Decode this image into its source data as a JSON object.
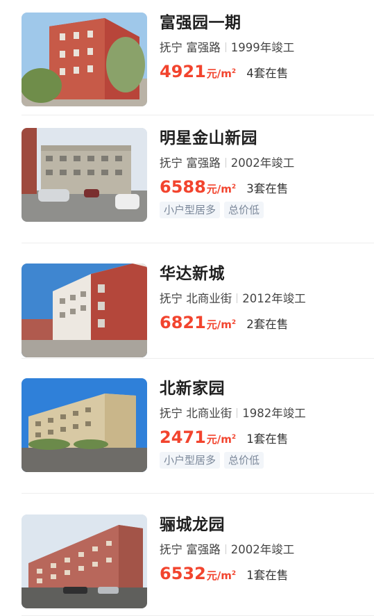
{
  "listings": [
    {
      "name": "富强园一期",
      "district": "抚宁",
      "road": "富强路",
      "built": "1999年竣工",
      "price": "4921",
      "unit": "元/m",
      "unit_sup": "2",
      "on_sale": "4套在售",
      "tags": [],
      "photo_icon": "apartment-photo"
    },
    {
      "name": "明星金山新园",
      "district": "抚宁",
      "road": "富强路",
      "built": "2002年竣工",
      "price": "6588",
      "unit": "元/m",
      "unit_sup": "2",
      "on_sale": "3套在售",
      "tags": [
        "小户型居多",
        "总价低"
      ],
      "photo_icon": "apartment-photo"
    },
    {
      "name": "华达新城",
      "district": "抚宁",
      "road": "北商业街",
      "built": "2012年竣工",
      "price": "6821",
      "unit": "元/m",
      "unit_sup": "2",
      "on_sale": "2套在售",
      "tags": [],
      "photo_icon": "apartment-photo"
    },
    {
      "name": "北新家园",
      "district": "抚宁",
      "road": "北商业街",
      "built": "1982年竣工",
      "price": "2471",
      "unit": "元/m",
      "unit_sup": "2",
      "on_sale": "1套在售",
      "tags": [
        "小户型居多",
        "总价低"
      ],
      "photo_icon": "apartment-photo"
    },
    {
      "name": "骊城龙园",
      "district": "抚宁",
      "road": "富强路",
      "built": "2002年竣工",
      "price": "6532",
      "unit": "元/m",
      "unit_sup": "2",
      "on_sale": "1套在售",
      "tags": [],
      "photo_icon": "apartment-photo"
    }
  ],
  "colors": {
    "price": "#f2442e",
    "tag_text": "#7a8799",
    "tag_bg": "#f2f5f9"
  }
}
